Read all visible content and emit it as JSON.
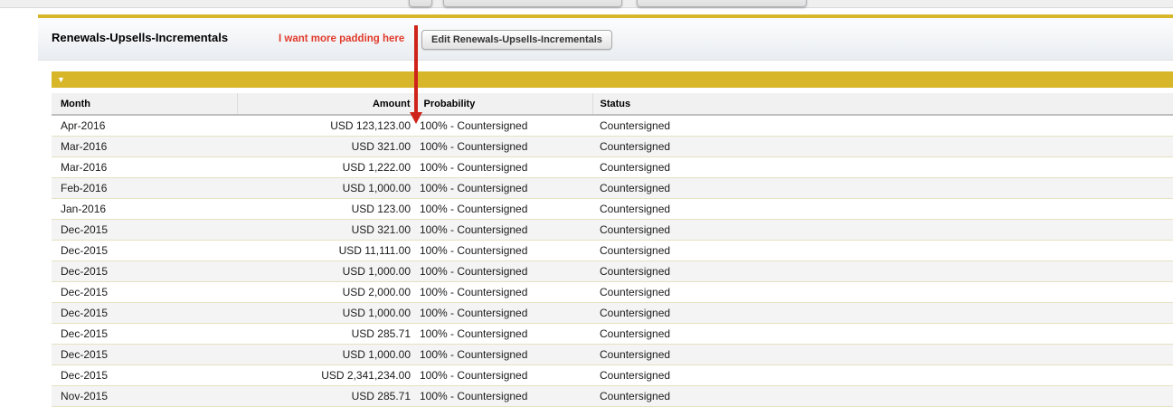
{
  "section": {
    "title": "Renewals-Upsells-Incrementals",
    "edit_button": "Edit Renewals-Upsells-Incrementals",
    "collapse_glyph": "▼"
  },
  "annotation": {
    "text": "I want more padding here"
  },
  "table": {
    "columns": [
      "Month",
      "Amount",
      "Probability",
      "Status"
    ],
    "rows": [
      {
        "month": "Apr-2016",
        "amount": "USD 123,123.00",
        "probability": "100% - Countersigned",
        "status": "Countersigned"
      },
      {
        "month": "Mar-2016",
        "amount": "USD 321.00",
        "probability": "100% - Countersigned",
        "status": "Countersigned"
      },
      {
        "month": "Mar-2016",
        "amount": "USD 1,222.00",
        "probability": "100% - Countersigned",
        "status": "Countersigned"
      },
      {
        "month": "Feb-2016",
        "amount": "USD 1,000.00",
        "probability": "100% - Countersigned",
        "status": "Countersigned"
      },
      {
        "month": "Jan-2016",
        "amount": "USD 123.00",
        "probability": "100% - Countersigned",
        "status": "Countersigned"
      },
      {
        "month": "Dec-2015",
        "amount": "USD 321.00",
        "probability": "100% - Countersigned",
        "status": "Countersigned"
      },
      {
        "month": "Dec-2015",
        "amount": "USD 11,111.00",
        "probability": "100% - Countersigned",
        "status": "Countersigned"
      },
      {
        "month": "Dec-2015",
        "amount": "USD 1,000.00",
        "probability": "100% - Countersigned",
        "status": "Countersigned"
      },
      {
        "month": "Dec-2015",
        "amount": "USD 2,000.00",
        "probability": "100% - Countersigned",
        "status": "Countersigned"
      },
      {
        "month": "Dec-2015",
        "amount": "USD 1,000.00",
        "probability": "100% - Countersigned",
        "status": "Countersigned"
      },
      {
        "month": "Dec-2015",
        "amount": "USD 285.71",
        "probability": "100% - Countersigned",
        "status": "Countersigned"
      },
      {
        "month": "Dec-2015",
        "amount": "USD 1,000.00",
        "probability": "100% - Countersigned",
        "status": "Countersigned"
      },
      {
        "month": "Dec-2015",
        "amount": "USD 2,341,234.00",
        "probability": "100% - Countersigned",
        "status": "Countersigned"
      },
      {
        "month": "Nov-2015",
        "amount": "USD 285.71",
        "probability": "100% - Countersigned",
        "status": "Countersigned"
      }
    ]
  },
  "colors": {
    "gold": "#D8B62A",
    "annotation_red": "#E23B2B",
    "arrow_red": "#CE231A"
  }
}
